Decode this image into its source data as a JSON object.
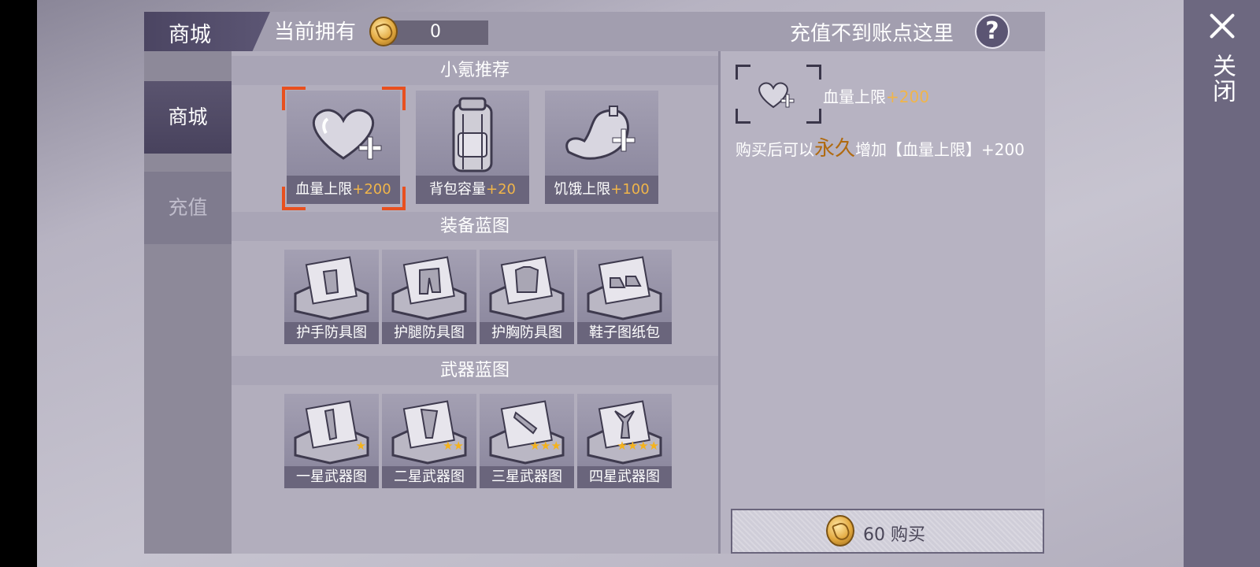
{
  "header": {
    "shop_title": "商城",
    "owned_label": "当前拥有",
    "balance": "0",
    "recharge_help": "充值不到账点这里",
    "help_symbol": "?",
    "coin_icon": "gold-coin-icon"
  },
  "close": {
    "label": "关闭",
    "icon": "close-icon"
  },
  "tabs": [
    {
      "label": "商城",
      "active": true
    },
    {
      "label": "充值",
      "active": false
    }
  ],
  "sections": {
    "recommend": {
      "title": "小氪推荐",
      "items": [
        {
          "name": "血量上限",
          "bonus": "+200",
          "icon": "heart-plus-icon",
          "selected": true
        },
        {
          "name": "背包容量",
          "bonus": "+20",
          "icon": "backpack-icon",
          "selected": false
        },
        {
          "name": "饥饿上限",
          "bonus": "+100",
          "icon": "stomach-plus-icon",
          "selected": false
        }
      ]
    },
    "equipment": {
      "title": "装备蓝图",
      "items": [
        {
          "name": "护手防具图",
          "icon": "blueprint-gloves-icon"
        },
        {
          "name": "护腿防具图",
          "icon": "blueprint-pants-icon"
        },
        {
          "name": "护胸防具图",
          "icon": "blueprint-chest-icon"
        },
        {
          "name": "鞋子图纸包",
          "icon": "blueprint-shoes-icon"
        }
      ]
    },
    "weapons": {
      "title": "武器蓝图",
      "items": [
        {
          "name": "一星武器图",
          "stars": 1,
          "icon": "blueprint-weapon-icon"
        },
        {
          "name": "二星武器图",
          "stars": 2,
          "icon": "blueprint-weapon-icon"
        },
        {
          "name": "三星武器图",
          "stars": 3,
          "icon": "blueprint-weapon-icon"
        },
        {
          "name": "四星武器图",
          "stars": 4,
          "icon": "blueprint-weapon-icon"
        }
      ]
    }
  },
  "detail": {
    "name": "血量上限",
    "bonus": "+200",
    "desc_prefix": "购买后可以",
    "desc_emphasis": "永久",
    "desc_suffix": "增加【血量上限】+200",
    "icon": "heart-plus-icon"
  },
  "buy": {
    "price": "60",
    "label": "购买",
    "icon": "gold-coin-icon"
  },
  "colors": {
    "accent_orange": "#f0b54a",
    "selection_frame": "#e8501f",
    "emphasis_brown": "#b06a10"
  }
}
